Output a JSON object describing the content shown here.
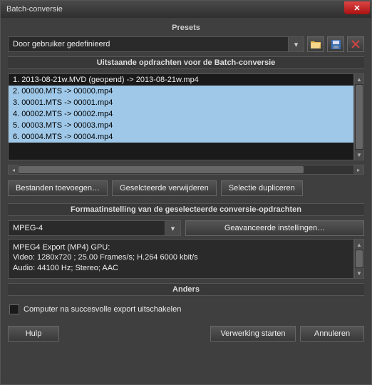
{
  "window": {
    "title": "Batch-conversie"
  },
  "presets": {
    "title": "Presets",
    "selected": "Door gebruiker gedefinieerd"
  },
  "queue": {
    "title": "Uitstaande opdrachten voor de Batch-conversie",
    "items": [
      {
        "text": "1. 2013-08-21w.MVD (geopend) -> 2013-08-21w.mp4",
        "selected": false
      },
      {
        "text": "2. 00000.MTS -> 00000.mp4",
        "selected": true
      },
      {
        "text": "3. 00001.MTS -> 00001.mp4",
        "selected": true
      },
      {
        "text": "4. 00002.MTS -> 00002.mp4",
        "selected": true
      },
      {
        "text": "5. 00003.MTS -> 00003.mp4",
        "selected": true
      },
      {
        "text": "6. 00004.MTS -> 00004.mp4",
        "selected": true
      }
    ],
    "buttons": {
      "add": "Bestanden toevoegen…",
      "remove": "Geselcteerde verwijderen",
      "duplicate": "Selectie dupliceren"
    }
  },
  "format": {
    "title": "Formaatinstelling van de geselecteerde conversie-opdrachten",
    "selected": "MPEG-4",
    "advanced": "Geavanceerde instellingen…",
    "info": "MPEG4 Export (MP4) GPU:\nVideo: 1280x720 ; 25.00 Frames/s; H.264 6000 kbit/s\nAudio: 44100 Hz; Stereo;  AAC"
  },
  "other": {
    "title": "Anders",
    "shutdown": "Computer na succesvolle export uitschakelen"
  },
  "footer": {
    "help": "Hulp",
    "start": "Verwerking starten",
    "cancel": "Annuleren"
  }
}
